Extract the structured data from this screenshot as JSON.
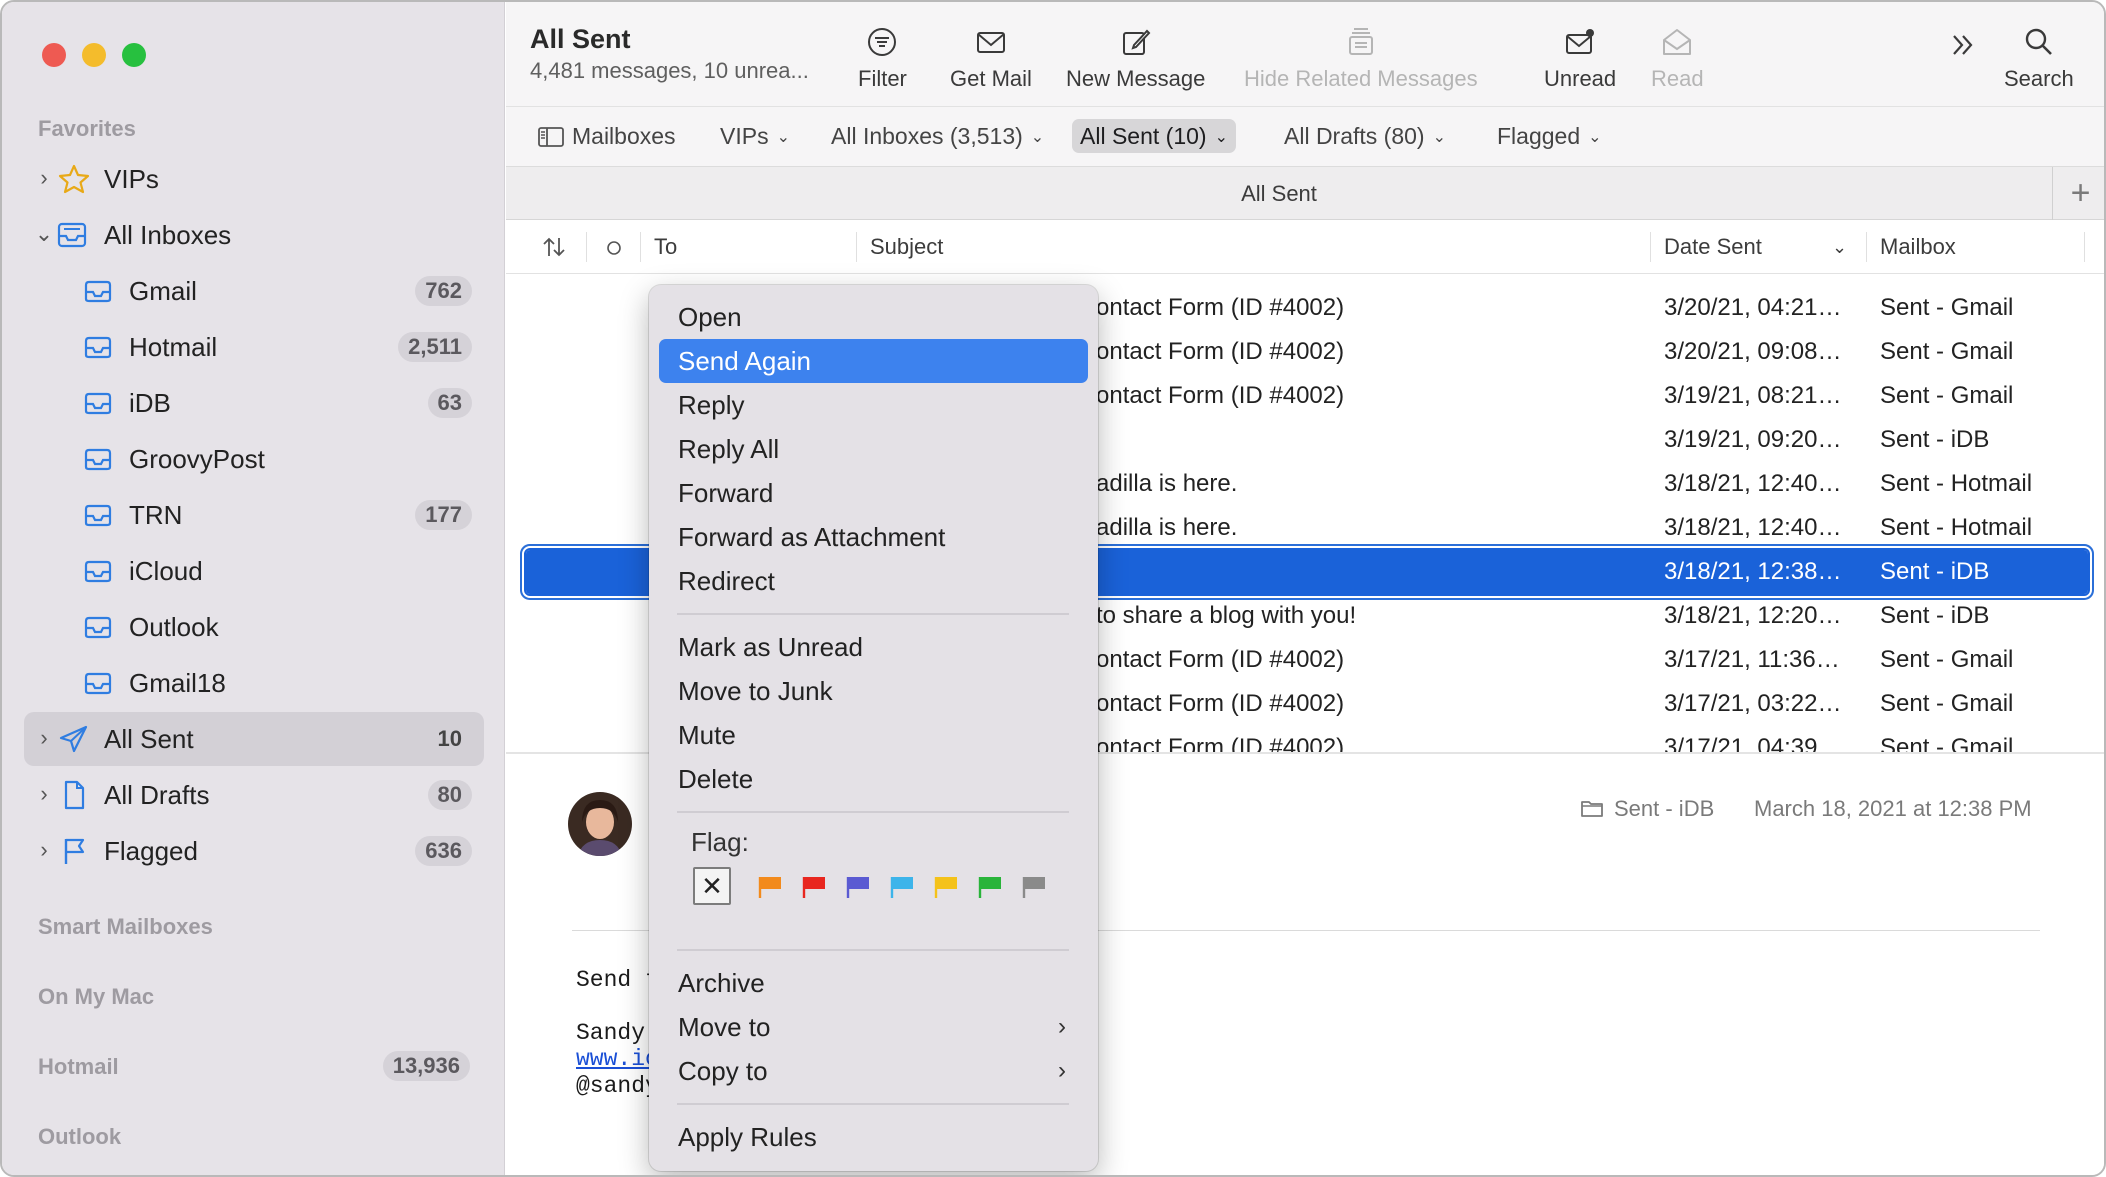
{
  "sidebar": {
    "favorites_header": "Favorites",
    "items": [
      {
        "label": "VIPs",
        "badge": "",
        "icon": "star-icon",
        "expandable": true
      },
      {
        "label": "All Inboxes",
        "badge": "",
        "icon": "inbox-tray-icon",
        "expanded": true
      },
      {
        "label": "Gmail",
        "badge": "762",
        "icon": "inbox-tray-icon"
      },
      {
        "label": "Hotmail",
        "badge": "2,511",
        "icon": "inbox-tray-icon"
      },
      {
        "label": "iDB",
        "badge": "63",
        "icon": "inbox-tray-icon"
      },
      {
        "label": "GroovyPost",
        "badge": "",
        "icon": "inbox-tray-icon"
      },
      {
        "label": "TRN",
        "badge": "177",
        "icon": "inbox-tray-icon"
      },
      {
        "label": "iCloud",
        "badge": "",
        "icon": "inbox-tray-icon"
      },
      {
        "label": "Outlook",
        "badge": "",
        "icon": "inbox-tray-icon"
      },
      {
        "label": "Gmail18",
        "badge": "",
        "icon": "inbox-tray-icon"
      },
      {
        "label": "All Sent",
        "badge": "10",
        "icon": "paper-plane-icon",
        "selected": true
      },
      {
        "label": "All Drafts",
        "badge": "80",
        "icon": "document-icon"
      },
      {
        "label": "Flagged",
        "badge": "636",
        "icon": "flag-outline-icon"
      }
    ],
    "smart_header": "Smart Mailboxes",
    "onmymac_header": "On My Mac",
    "hotmail_header": "Hotmail",
    "hotmail_count": "13,936",
    "outlook_header": "Outlook"
  },
  "toolbar": {
    "title": "All Sent",
    "subtitle": "4,481 messages, 10 unrea...",
    "filter": "Filter",
    "get_mail": "Get Mail",
    "new_message": "New Message",
    "hide_related": "Hide Related Messages",
    "unread": "Unread",
    "read": "Read",
    "search": "Search"
  },
  "favbar": {
    "mailboxes": "Mailboxes",
    "vips": "VIPs",
    "all_inboxes": "All Inboxes (3,513)",
    "all_sent": "All Sent (10)",
    "all_drafts": "All Drafts (80)",
    "flagged": "Flagged"
  },
  "tabbar": {
    "title": "All Sent",
    "add": "+"
  },
  "list": {
    "headers": {
      "to": "To",
      "subject": "Subject",
      "date_sent": "Date Sent",
      "mailbox": "Mailbox"
    },
    "rows": [
      {
        "subject": "ontact Form (ID #4002)",
        "date": "3/20/21, 04:21…",
        "mailbox": "Sent - Gmail"
      },
      {
        "subject": "ontact Form (ID #4002)",
        "date": "3/20/21, 09:08…",
        "mailbox": "Sent - Gmail"
      },
      {
        "subject": "ontact Form (ID #4002)",
        "date": "3/19/21, 08:21…",
        "mailbox": "Sent - Gmail"
      },
      {
        "subject": "",
        "date": "3/19/21, 09:20…",
        "mailbox": "Sent - iDB"
      },
      {
        "subject": "adilla is here.",
        "date": "3/18/21, 12:40…",
        "mailbox": "Sent - Hotmail"
      },
      {
        "subject": "adilla is here.",
        "date": "3/18/21, 12:40…",
        "mailbox": "Sent - Hotmail"
      },
      {
        "subject": "",
        "date": "3/18/21, 12:38…",
        "mailbox": "Sent - iDB",
        "selected": true
      },
      {
        "subject": "to share a blog with you!",
        "date": "3/18/21, 12:20…",
        "mailbox": "Sent - iDB"
      },
      {
        "subject": "ontact Form (ID #4002)",
        "date": "3/17/21, 11:36…",
        "mailbox": "Sent - Gmail"
      },
      {
        "subject": "ontact Form (ID #4002)",
        "date": "3/17/21, 03:22…",
        "mailbox": "Sent - Gmail"
      },
      {
        "subject": "ontact Form (ID #4002)",
        "date": "3/17/21, 04:39…",
        "mailbox": "Sent - Gmail"
      }
    ]
  },
  "preview": {
    "mailbox": "Sent - iDB",
    "date": "March 18, 2021 at 12:38 PM",
    "body_line1": "Send t",
    "body_line2": "Sandy",
    "body_link": "www.ic",
    "body_line4": "@sandy"
  },
  "context_menu": {
    "items": [
      "Open",
      "Send Again",
      "Reply",
      "Reply All",
      "Forward",
      "Forward as Attachment",
      "Redirect",
      "Mark as Unread",
      "Move to Junk",
      "Mute",
      "Delete",
      "Archive",
      "Move to",
      "Copy to",
      "Apply Rules"
    ],
    "highlighted": "Send Again",
    "flag_label": "Flag:",
    "flag_colors": [
      "#f28a1c",
      "#e8261f",
      "#5a5ad2",
      "#3db4ea",
      "#f4c21a",
      "#29b43a",
      "#8a8a8a"
    ]
  },
  "colors": {
    "accent_blue": "#1a62d9",
    "menu_highlight": "#3d82ee",
    "close_red": "#ee5a52",
    "minimize_yellow": "#f4bc2c",
    "zoom_green": "#27c03f"
  }
}
